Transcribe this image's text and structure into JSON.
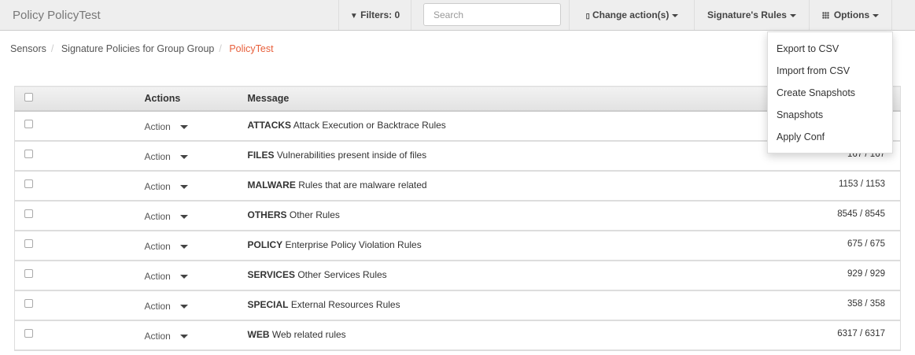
{
  "navbar": {
    "title": "Policy PolicyTest",
    "filters_label": "Filters: 0",
    "search_placeholder": "Search",
    "change_actions_label": "Change action(s)",
    "signature_rules_label": "Signature's Rules",
    "options_label": "Options"
  },
  "breadcrumb": [
    "Sensors",
    "Signature Policies for Group Group",
    "PolicyTest"
  ],
  "table": {
    "headers": {
      "actions": "Actions",
      "message": "Message"
    },
    "rows": [
      {
        "action": "Action",
        "category": "ATTACKS",
        "description": "Attack Execution or Backtrace Rules",
        "count": ""
      },
      {
        "action": "Action",
        "category": "FILES",
        "description": "Vulnerabilities present inside of files",
        "count": "167 / 167"
      },
      {
        "action": "Action",
        "category": "MALWARE",
        "description": "Rules that are malware related",
        "count": "1153 / 1153"
      },
      {
        "action": "Action",
        "category": "OTHERS",
        "description": "Other Rules",
        "count": "8545 / 8545"
      },
      {
        "action": "Action",
        "category": "POLICY",
        "description": "Enterprise Policy Violation Rules",
        "count": "675 / 675"
      },
      {
        "action": "Action",
        "category": "SERVICES",
        "description": "Other Services Rules",
        "count": "929 / 929"
      },
      {
        "action": "Action",
        "category": "SPECIAL",
        "description": "External Resources Rules",
        "count": "358 / 358"
      },
      {
        "action": "Action",
        "category": "WEB",
        "description": "Web related rules",
        "count": "6317 / 6317"
      }
    ]
  },
  "options_menu": [
    "Export to CSV",
    "Import from CSV",
    "Create Snapshots",
    "Snapshots",
    "Apply Conf"
  ],
  "colors": {
    "breadcrumb_active": "#e8603c",
    "navbar_bg": "#eeeeee"
  }
}
